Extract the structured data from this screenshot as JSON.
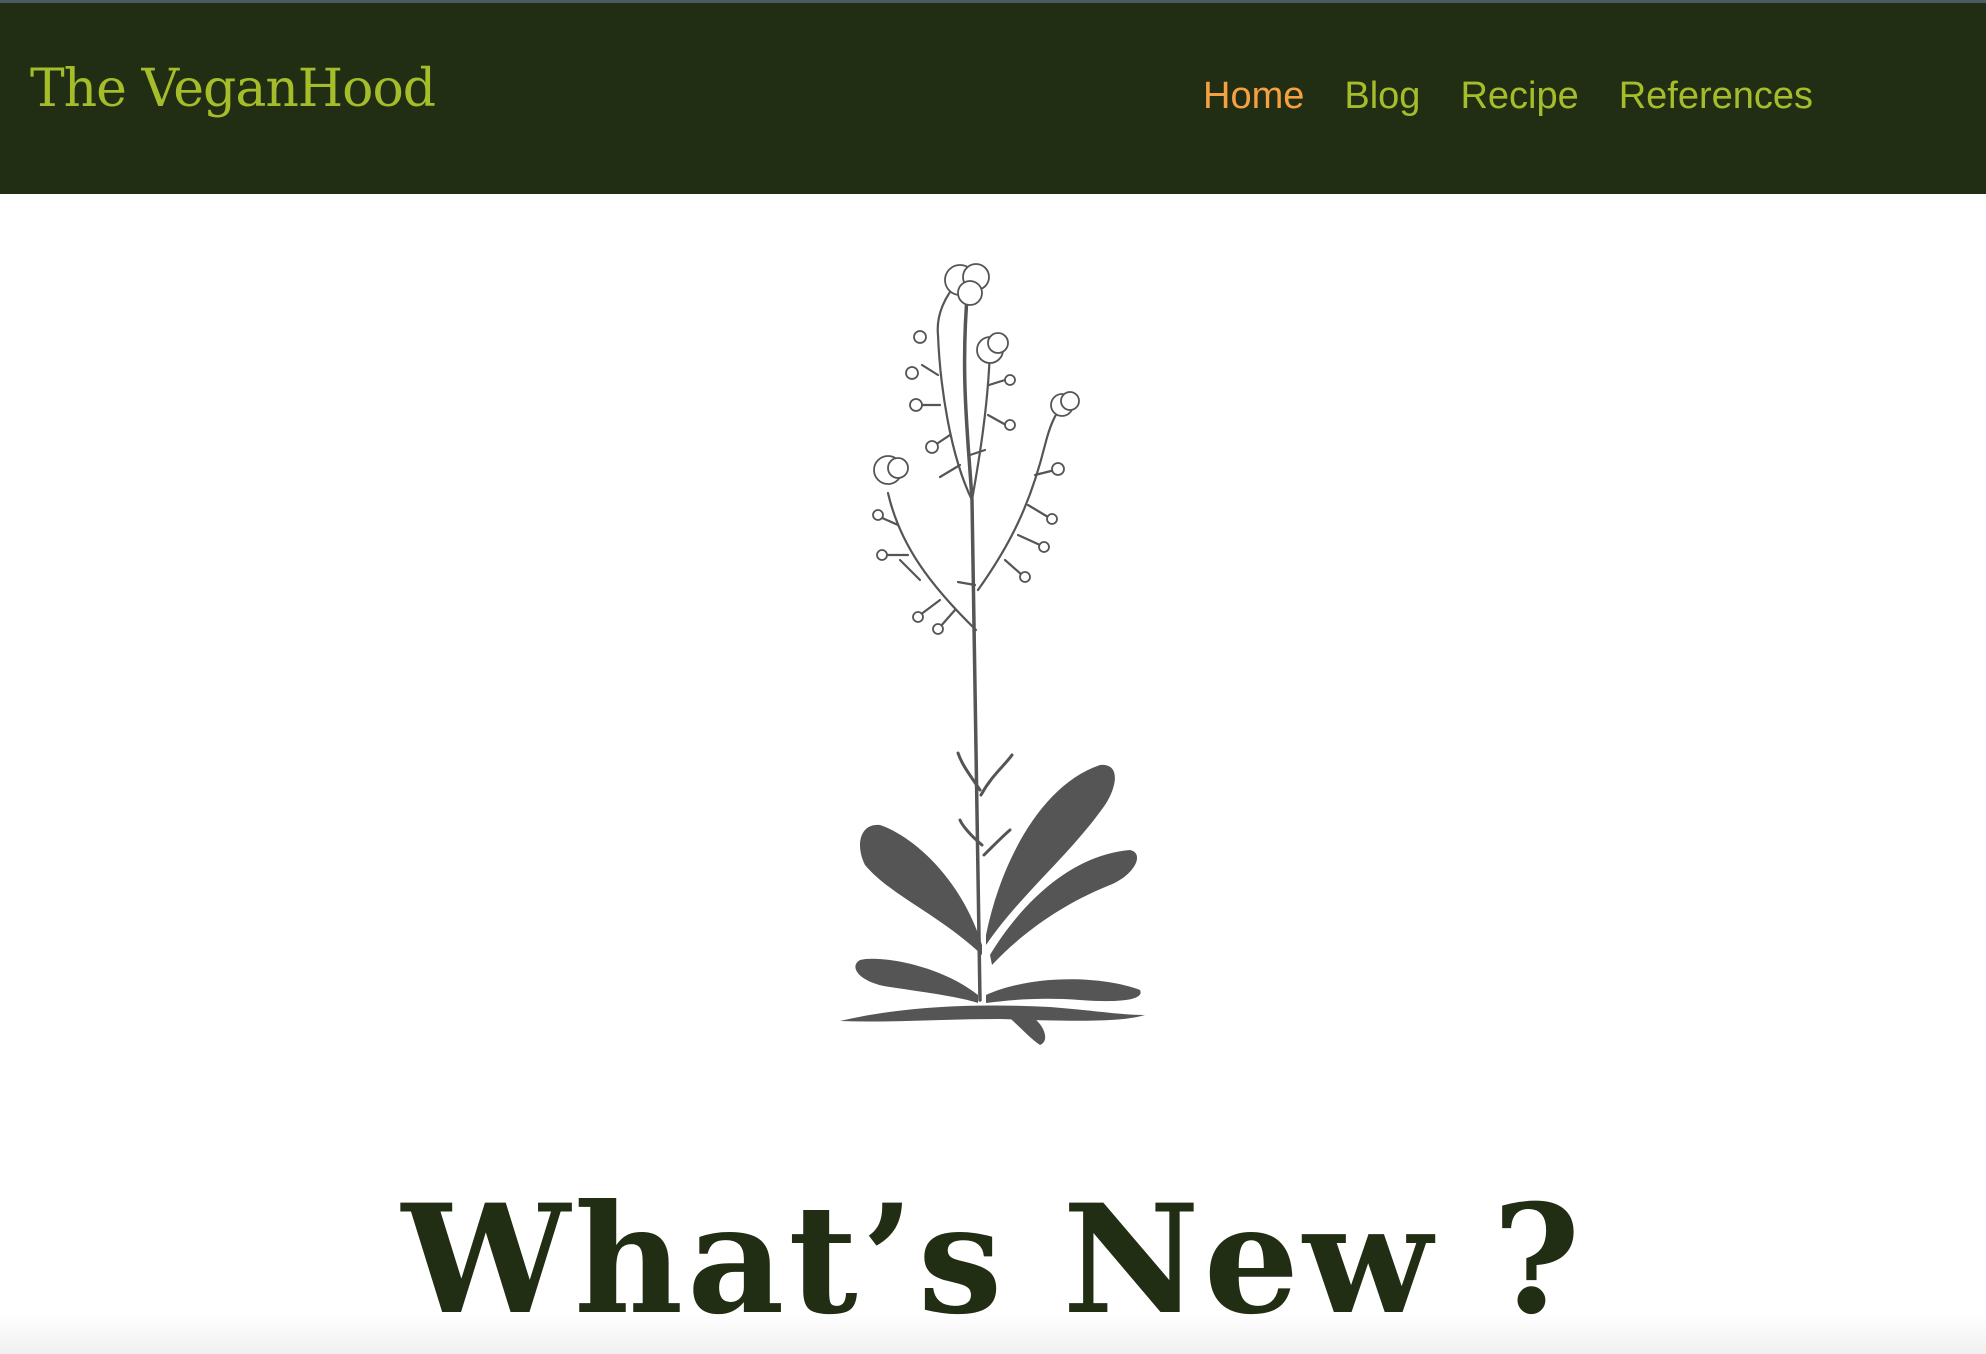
{
  "header": {
    "brand": "The VeganHood",
    "nav": [
      {
        "label": "Home",
        "active": true
      },
      {
        "label": "Blog",
        "active": false
      },
      {
        "label": "Recipe",
        "active": false
      },
      {
        "label": "References",
        "active": false
      }
    ]
  },
  "hero": {
    "image": "plant-illustration"
  },
  "section": {
    "title": "What’s New ?"
  },
  "colors": {
    "nav_bg": "#222e13",
    "brand": "#a6bd2b",
    "active": "#f5a142",
    "heading": "#222e13",
    "plant": "#555555"
  }
}
